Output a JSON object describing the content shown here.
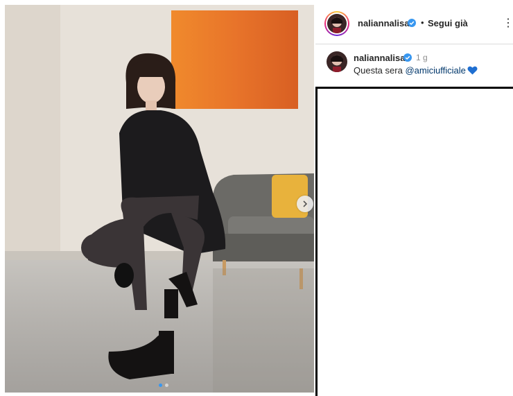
{
  "post": {
    "username": "naliannalisa",
    "separator": "•",
    "follow_label": "Segui già",
    "more_icon": "⋮",
    "image_description_icon": "post-photo",
    "carousel": {
      "current": 1,
      "total": 2
    }
  },
  "caption": {
    "username": "naliannalisa",
    "time": "1 g",
    "text_prefix": "Questa sera ",
    "mention": "@amiciufficiale"
  },
  "colors": {
    "verified": "#3897f0",
    "mention": "#00376b",
    "heart": "#1f6fd1",
    "painting": "#e8742a"
  }
}
